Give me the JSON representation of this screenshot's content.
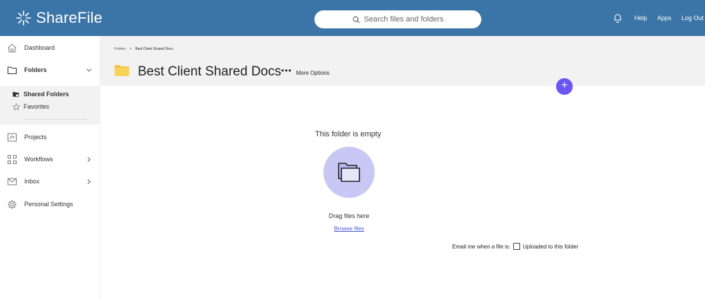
{
  "header": {
    "logo": "ShareFile",
    "search_placeholder": "Search files and folders",
    "help": "Help",
    "apps": "Apps",
    "logout": "Log Out"
  },
  "sidebar": {
    "dashboard": "Dashboard",
    "folders": "Folders",
    "shared_folders": "Shared Folders",
    "favorites": "Favorites",
    "projects": "Projects",
    "workflows": "Workflows",
    "inbox": "Inbox",
    "personal_settings": "Personal Settings"
  },
  "breadcrumb": {
    "root": "Folders",
    "separator": ">",
    "current": "Best Client Shared Docs"
  },
  "page": {
    "title": "Best Client Shared Docs",
    "more_options": "More Options",
    "add_label": "+"
  },
  "empty_state": {
    "title": "This folder is empty",
    "drag": "Drag files here",
    "browse": "Browse files"
  },
  "notify": {
    "label": "Email me when a file is:",
    "option": "Uploaded to this folder"
  },
  "colors": {
    "header_bg": "#3b74a6",
    "accent": "#6b55f5",
    "empty_circle": "#c9c8f5",
    "link": "#4a56d8",
    "folder_yellow": "#f4c542"
  }
}
